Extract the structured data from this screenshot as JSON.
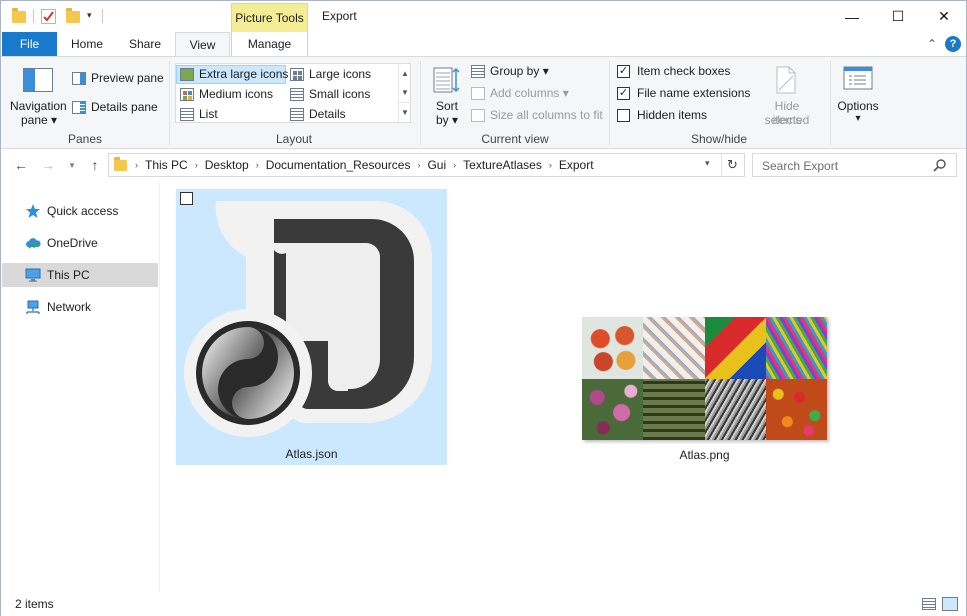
{
  "titlebar": {
    "context_tab": "Picture Tools",
    "title": "Export",
    "minimize": "—",
    "maximize": "☐",
    "close": "✕"
  },
  "tabs": {
    "file": "File",
    "home": "Home",
    "share": "Share",
    "view": "View",
    "manage": "Manage",
    "collapse": "⌃",
    "help": "?"
  },
  "ribbon": {
    "panes": {
      "label": "Panes",
      "navigation_pane": "Navigation",
      "navigation_pane_2": "pane ▾",
      "preview_pane": "Preview pane",
      "details_pane": "Details pane"
    },
    "layout": {
      "label": "Layout",
      "options": [
        "Extra large icons",
        "Large icons",
        "Medium icons",
        "Small icons",
        "List",
        "Details"
      ],
      "selected": "Extra large icons",
      "scroll_up": "▲",
      "scroll_down": "▼",
      "scroll_more": "▼"
    },
    "current_view": {
      "label": "Current view",
      "sort_by": "Sort",
      "sort_by_2": "by ▾",
      "group_by": "Group by ▾",
      "add_columns": "Add columns ▾",
      "size_columns": "Size all columns to fit"
    },
    "show_hide": {
      "label": "Show/hide",
      "item_check_boxes": "Item check boxes",
      "file_name_extensions": "File name extensions",
      "hidden_items": "Hidden items",
      "item_check_boxes_checked": true,
      "file_name_extensions_checked": true,
      "hidden_items_checked": false,
      "hide_selected": "Hide selected",
      "hide_selected_2": "items"
    },
    "options": {
      "label": "Options",
      "arrow": "▾"
    }
  },
  "address": {
    "breadcrumbs": [
      "This PC",
      "Desktop",
      "Documentation_Resources",
      "Gui",
      "TextureAtlases",
      "Export"
    ],
    "search_placeholder": "Search Export"
  },
  "nav_pane": {
    "items": [
      {
        "label": "Quick access",
        "icon": "star-icon"
      },
      {
        "label": "OneDrive",
        "icon": "cloud-icon"
      },
      {
        "label": "This PC",
        "icon": "computer-icon",
        "selected": true
      },
      {
        "label": "Network",
        "icon": "network-icon"
      }
    ]
  },
  "files": [
    {
      "name": "Atlas.json",
      "icon": "json-file-icon",
      "selected": true
    },
    {
      "name": "Atlas.png",
      "icon": "image-thumbnail"
    }
  ],
  "status": {
    "item_count": "2 items"
  },
  "colors": {
    "accent": "#1979ca",
    "selection": "#cce8ff",
    "context_tab": "#f5ed95"
  }
}
